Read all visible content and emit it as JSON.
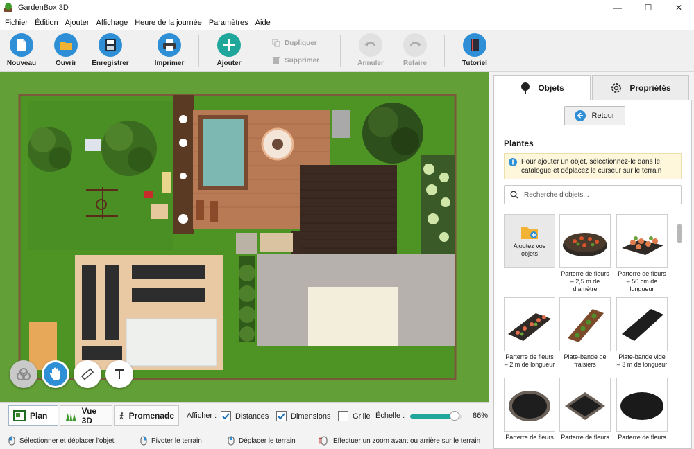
{
  "app": {
    "title": "GardenBox 3D"
  },
  "window": {
    "minimize": "—",
    "maximize": "☐",
    "close": "✕"
  },
  "menu": [
    "Fichier",
    "Édition",
    "Ajouter",
    "Affichage",
    "Heure de la journée",
    "Paramètres",
    "Aide"
  ],
  "toolbar": {
    "new": "Nouveau",
    "open": "Ouvrir",
    "save": "Enregistrer",
    "print": "Imprimer",
    "add": "Ajouter",
    "duplicate": "Dupliquer",
    "delete": "Supprimer",
    "undo": "Annuler",
    "redo": "Refaire",
    "tutorial": "Tutoriel"
  },
  "panel": {
    "tab_objects": "Objets",
    "tab_properties": "Propriétés",
    "back": "Retour",
    "category": "Plantes",
    "info": "Pour ajouter un objet, sélectionnez-le dans le catalogue et déplacez le curseur sur le terrain",
    "search_placeholder": "Recherche d'objets...",
    "add_own": "Ajoutez vos objets",
    "items": [
      "Parterre de fleurs – 2,5 m de diamètre",
      "Parterre de fleurs – 50 cm de longueur",
      "Parterre de fleurs – 2 m de longueur",
      "Plate-bande de fraisiers",
      "Plate-bande vide – 3 m de longueur",
      "Parterre de fleurs",
      "Parterre de fleurs",
      "Parterre de fleurs"
    ]
  },
  "viewbar": {
    "plan": "Plan",
    "view3d": "Vue 3D",
    "walk": "Promenade",
    "show": "Afficher :",
    "distances": "Distances",
    "dimensions": "Dimensions",
    "grid": "Grille",
    "scale": "Échelle :",
    "scale_value": "86%",
    "scale_level": 0.86
  },
  "status": {
    "select": "Sélectionner et déplacer l'objet",
    "rotate": "Pivoter le terrain",
    "move": "Déplacer le terrain",
    "zoom": "Effectuer un zoom avant ou arrière sur le terrain"
  },
  "colors": {
    "accent": "#2e8fd6",
    "add": "#1fa79b",
    "grass": "#5f9e35",
    "deck": "#b77a55"
  }
}
